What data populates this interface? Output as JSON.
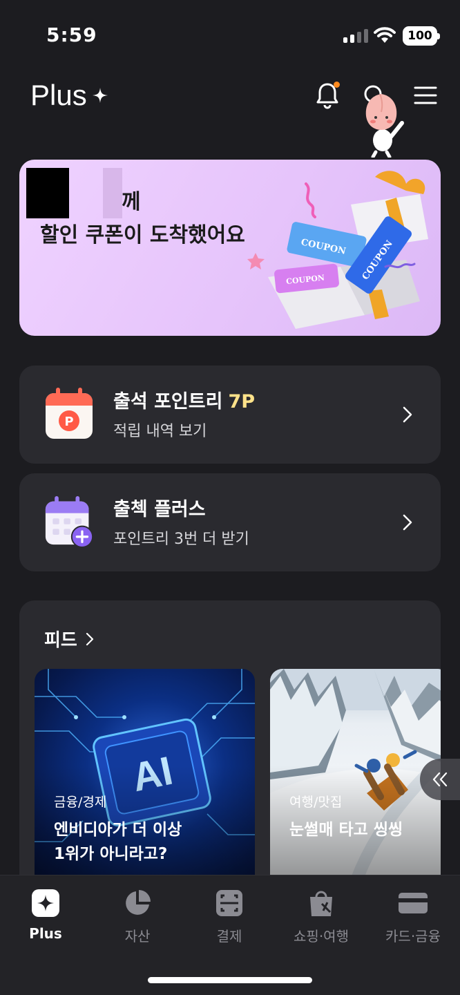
{
  "status_bar": {
    "time": "5:59",
    "battery": "100"
  },
  "header": {
    "logo": "Plus",
    "icons": [
      "bell-icon",
      "search-icon",
      "menu-icon"
    ],
    "notification_dot_color": "#ff8a1e"
  },
  "banner": {
    "line1": "께",
    "line2": "할인 쿠폰이 도착했어요",
    "coupon_text": "COUPON",
    "background": "#eccdfd"
  },
  "cards": [
    {
      "title": "출석 포인트리",
      "highlight": "7P",
      "subtitle": "적립 내역 보기",
      "icon": "calendar-p-icon"
    },
    {
      "title": "출첵 플러스",
      "subtitle": "포인트리 3번 더 받기",
      "icon": "calendar-plus-icon"
    }
  ],
  "feed": {
    "title": "피드",
    "items": [
      {
        "category": "금융/경제",
        "title_line1": "엔비디아가 더 이상",
        "title_line2": "1위가 아니라고?",
        "image_text": "AI"
      },
      {
        "category": "여행/맛집",
        "title_line1": "눈썰매 타고 씽씽"
      }
    ]
  },
  "tabbar": {
    "tabs": [
      {
        "label": "Plus",
        "icon": "plus-sparkle-icon",
        "active": true
      },
      {
        "label": "자산",
        "icon": "pie-chart-icon",
        "active": false
      },
      {
        "label": "결제",
        "icon": "scan-pay-icon",
        "active": false
      },
      {
        "label": "쇼핑·여행",
        "icon": "shopping-bag-icon",
        "active": false
      },
      {
        "label": "카드·금융",
        "icon": "card-icon",
        "active": false
      }
    ]
  }
}
